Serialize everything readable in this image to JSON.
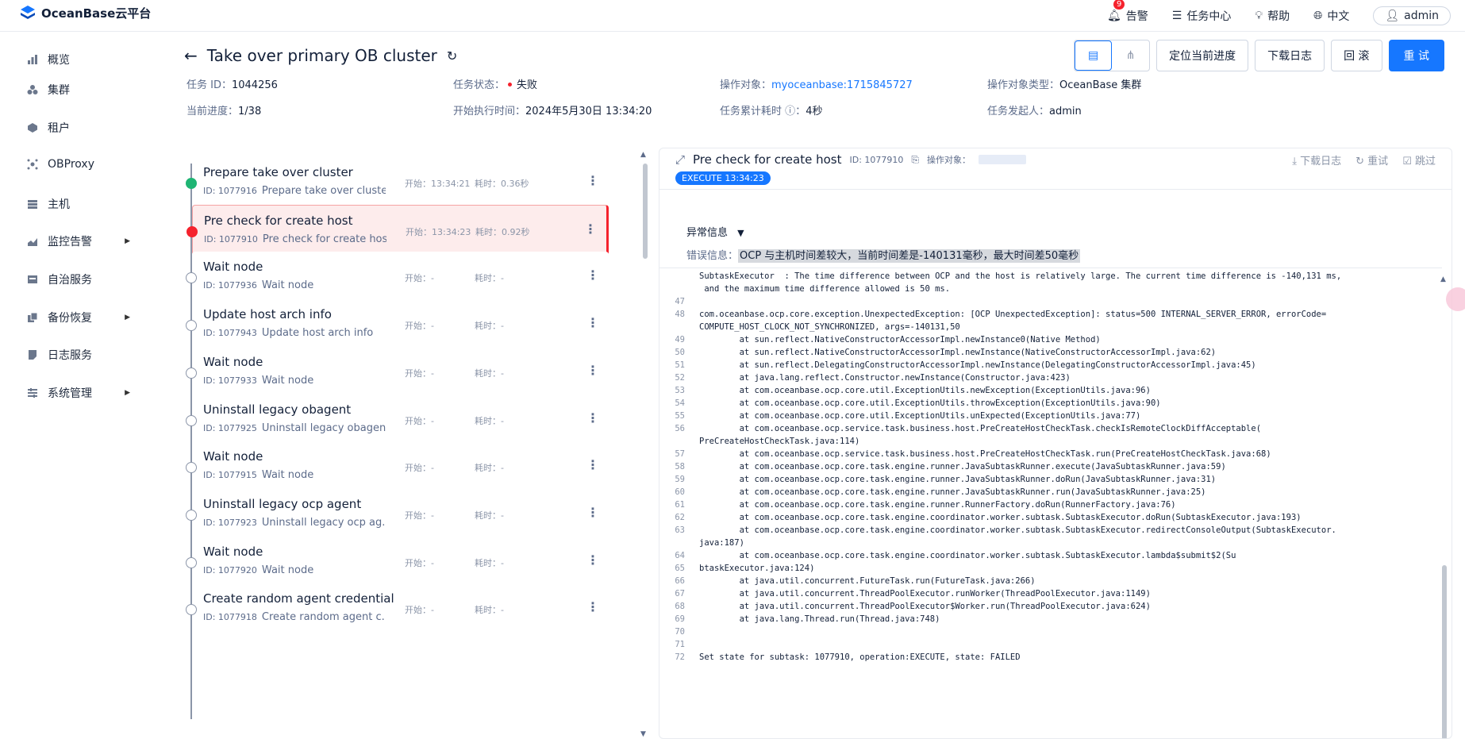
{
  "brand": {
    "name": "OceanBase云平台"
  },
  "topnav": {
    "alerts": "告警",
    "alert_count": "9",
    "tasks": "任务中心",
    "help": "帮助",
    "lang": "中文",
    "user": "admin"
  },
  "sidebar": {
    "items": [
      {
        "label": "概览",
        "icon": "bar-chart-icon"
      },
      {
        "label": "集群",
        "icon": "cluster-icon"
      },
      {
        "label": "租户",
        "icon": "tenant-icon"
      },
      {
        "label": "OBProxy",
        "icon": "proxy-icon"
      },
      {
        "label": "主机",
        "icon": "host-icon"
      },
      {
        "label": "监控告警",
        "icon": "monitor-icon",
        "expandable": true
      },
      {
        "label": "自治服务",
        "icon": "service-icon"
      },
      {
        "label": "备份恢复",
        "icon": "backup-icon",
        "expandable": true
      },
      {
        "label": "日志服务",
        "icon": "log-icon"
      },
      {
        "label": "系统管理",
        "icon": "settings-icon",
        "expandable": true
      }
    ]
  },
  "page": {
    "title": "Take over primary OB cluster",
    "buttons": {
      "locate": "定位当前进度",
      "download": "下载日志",
      "rollback": "回 滚",
      "retry": "重 试"
    },
    "meta": {
      "task_id_label": "任务 ID：",
      "task_id": "1044256",
      "status_label": "任务状态：",
      "status": "失败",
      "target_label": "操作对象：",
      "target": "myoceanbase:1715845727",
      "target_type_label": "操作对象类型：",
      "target_type": "OceanBase 集群",
      "progress_label": "当前进度：",
      "progress": "1/38",
      "start_label": "开始执行时间：",
      "start": "2024年5月30日 13:34:20",
      "elapsed_label": "任务累计耗时",
      "elapsed": "4秒",
      "initiator_label": "任务发起人：",
      "initiator": "admin"
    }
  },
  "steps": [
    {
      "name": "Prepare take over cluster",
      "id": "ID: 1077916",
      "desc": "Prepare take over cluster",
      "start": "开始：13:34:21",
      "cost": "耗时：0.36秒",
      "state": "ok"
    },
    {
      "name": "Pre check for create host",
      "id": "ID: 1077910",
      "desc": "Pre check for create host",
      "start": "开始：13:34:23",
      "cost": "耗时：0.92秒",
      "state": "err"
    },
    {
      "name": "Wait node",
      "id": "ID: 1077936",
      "desc": "Wait node",
      "start": "开始：-",
      "cost": "耗时：-",
      "state": "pending"
    },
    {
      "name": "Update host arch info",
      "id": "ID: 1077943",
      "desc": "Update host arch info",
      "start": "开始：-",
      "cost": "耗时：-",
      "state": "pending"
    },
    {
      "name": "Wait node",
      "id": "ID: 1077933",
      "desc": "Wait node",
      "start": "开始：-",
      "cost": "耗时：-",
      "state": "pending"
    },
    {
      "name": "Uninstall legacy obagent",
      "id": "ID: 1077925",
      "desc": "Uninstall legacy obagent",
      "start": "开始：-",
      "cost": "耗时：-",
      "state": "pending"
    },
    {
      "name": "Wait node",
      "id": "ID: 1077915",
      "desc": "Wait node",
      "start": "开始：-",
      "cost": "耗时：-",
      "state": "pending"
    },
    {
      "name": "Uninstall legacy ocp agent",
      "id": "ID: 1077923",
      "desc": "Uninstall legacy ocp ag...",
      "start": "开始：-",
      "cost": "耗时：-",
      "state": "pending"
    },
    {
      "name": "Wait node",
      "id": "ID: 1077920",
      "desc": "Wait node",
      "start": "开始：-",
      "cost": "耗时：-",
      "state": "pending"
    },
    {
      "name": "Create random agent credential",
      "id": "ID: 1077918",
      "desc": "Create random agent c...",
      "start": "开始：-",
      "cost": "耗时：-",
      "state": "pending"
    }
  ],
  "detail": {
    "title": "Pre check for create host",
    "id": "ID: 1077910",
    "target_label": "操作对象：",
    "actions": {
      "download": "下载日志",
      "retry": "重试",
      "skip": "跳过"
    },
    "exec_tag": "EXECUTE 13:34:23",
    "error_title": "异常信息",
    "error_label": "错误信息：",
    "error_msg": "OCP 与主机时间差较大，当前时间差是-140131毫秒，最大时间差50毫秒",
    "log": [
      {
        "n": "",
        "t": "SubtaskExecutor  : The time difference between OCP and the host is relatively large. The current time difference is -140,131 ms,"
      },
      {
        "n": "",
        "t": " and the maximum time difference allowed is 50 ms."
      },
      {
        "n": "47",
        "t": ""
      },
      {
        "n": "48",
        "t": "com.oceanbase.ocp.core.exception.UnexpectedException: [OCP UnexpectedException]: status=500 INTERNAL_SERVER_ERROR, errorCode="
      },
      {
        "n": "",
        "t": "COMPUTE_HOST_CLOCK_NOT_SYNCHRONIZED, args=-140131,50"
      },
      {
        "n": "49",
        "t": "        at sun.reflect.NativeConstructorAccessorImpl.newInstance0(Native Method)"
      },
      {
        "n": "50",
        "t": "        at sun.reflect.NativeConstructorAccessorImpl.newInstance(NativeConstructorAccessorImpl.java:62)"
      },
      {
        "n": "51",
        "t": "        at sun.reflect.DelegatingConstructorAccessorImpl.newInstance(DelegatingConstructorAccessorImpl.java:45)"
      },
      {
        "n": "52",
        "t": "        at java.lang.reflect.Constructor.newInstance(Constructor.java:423)"
      },
      {
        "n": "53",
        "t": "        at com.oceanbase.ocp.core.util.ExceptionUtils.newException(ExceptionUtils.java:96)"
      },
      {
        "n": "54",
        "t": "        at com.oceanbase.ocp.core.util.ExceptionUtils.throwException(ExceptionUtils.java:90)"
      },
      {
        "n": "55",
        "t": "        at com.oceanbase.ocp.core.util.ExceptionUtils.unExpected(ExceptionUtils.java:77)"
      },
      {
        "n": "56",
        "t": "        at com.oceanbase.ocp.service.task.business.host.PreCreateHostCheckTask.checkIsRemoteClockDiffAcceptable("
      },
      {
        "n": "",
        "t": "PreCreateHostCheckTask.java:114)"
      },
      {
        "n": "57",
        "t": "        at com.oceanbase.ocp.service.task.business.host.PreCreateHostCheckTask.run(PreCreateHostCheckTask.java:68)"
      },
      {
        "n": "58",
        "t": "        at com.oceanbase.ocp.core.task.engine.runner.JavaSubtaskRunner.execute(JavaSubtaskRunner.java:59)"
      },
      {
        "n": "59",
        "t": "        at com.oceanbase.ocp.core.task.engine.runner.JavaSubtaskRunner.doRun(JavaSubtaskRunner.java:31)"
      },
      {
        "n": "60",
        "t": "        at com.oceanbase.ocp.core.task.engine.runner.JavaSubtaskRunner.run(JavaSubtaskRunner.java:25)"
      },
      {
        "n": "61",
        "t": "        at com.oceanbase.ocp.core.task.engine.runner.RunnerFactory.doRun(RunnerFactory.java:76)"
      },
      {
        "n": "62",
        "t": "        at com.oceanbase.ocp.core.task.engine.coordinator.worker.subtask.SubtaskExecutor.doRun(SubtaskExecutor.java:193)"
      },
      {
        "n": "63",
        "t": "        at com.oceanbase.ocp.core.task.engine.coordinator.worker.subtask.SubtaskExecutor.redirectConsoleOutput(SubtaskExecutor."
      },
      {
        "n": "",
        "t": "java:187)"
      },
      {
        "n": "64",
        "t": "        at com.oceanbase.ocp.core.task.engine.coordinator.worker.subtask.SubtaskExecutor.lambda$submit$2(Su"
      },
      {
        "n": "65",
        "t": "btaskExecutor.java:124)"
      },
      {
        "n": "66",
        "t": "        at java.util.concurrent.FutureTask.run(FutureTask.java:266)"
      },
      {
        "n": "67",
        "t": "        at java.util.concurrent.ThreadPoolExecutor.runWorker(ThreadPoolExecutor.java:1149)"
      },
      {
        "n": "68",
        "t": "        at java.util.concurrent.ThreadPoolExecutor$Worker.run(ThreadPoolExecutor.java:624)"
      },
      {
        "n": "69",
        "t": "        at java.lang.Thread.run(Thread.java:748)"
      },
      {
        "n": "70",
        "t": ""
      },
      {
        "n": "71",
        "t": ""
      },
      {
        "n": "72",
        "t": "Set state for subtask: 1077910, operation:EXECUTE, state: FAILED"
      }
    ]
  },
  "colors": {
    "primary": "#1677ff",
    "error": "#f5222d",
    "success": "#1fb574"
  }
}
